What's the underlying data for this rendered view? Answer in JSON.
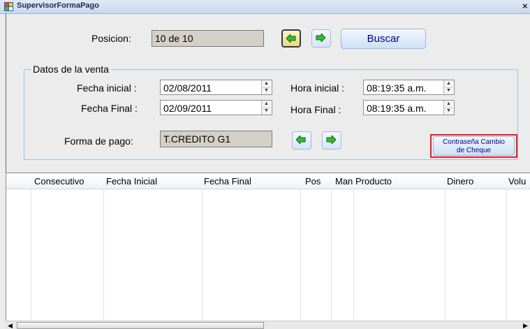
{
  "window": {
    "title": "SupervisorFormaPago",
    "close_glyph": "×"
  },
  "nav": {
    "posicion_label": "Posicion:",
    "posicion_value": "10 de 10",
    "prev_icon": "arrow-left-icon",
    "next_icon": "arrow-right-icon",
    "buscar_label": "Buscar"
  },
  "datos": {
    "group_title": "Datos de la venta",
    "fecha_inicial_label": "Fecha inicial :",
    "fecha_inicial_value": "02/08/2011",
    "fecha_final_label": "Fecha Final :",
    "fecha_final_value": "02/09/2011",
    "hora_inicial_label": "Hora inicial :",
    "hora_inicial_value": "08:19:35 a.m.",
    "hora_final_label": "Hora Final :",
    "hora_final_value": "08:19:35 a.m.",
    "forma_pago_label": "Forma de pago:",
    "forma_pago_value": "T.CREDITO G1",
    "contrasena_line1": "Contraseña Cambio",
    "contrasena_line2": "de Cheque",
    "highlight_color": "#e0222b"
  },
  "grid": {
    "columns": [
      "Consecutivo",
      "Fecha Inicial",
      "Fecha Final",
      "Pos",
      "Man",
      "Producto",
      "Dinero",
      "Volu"
    ],
    "rows": []
  }
}
